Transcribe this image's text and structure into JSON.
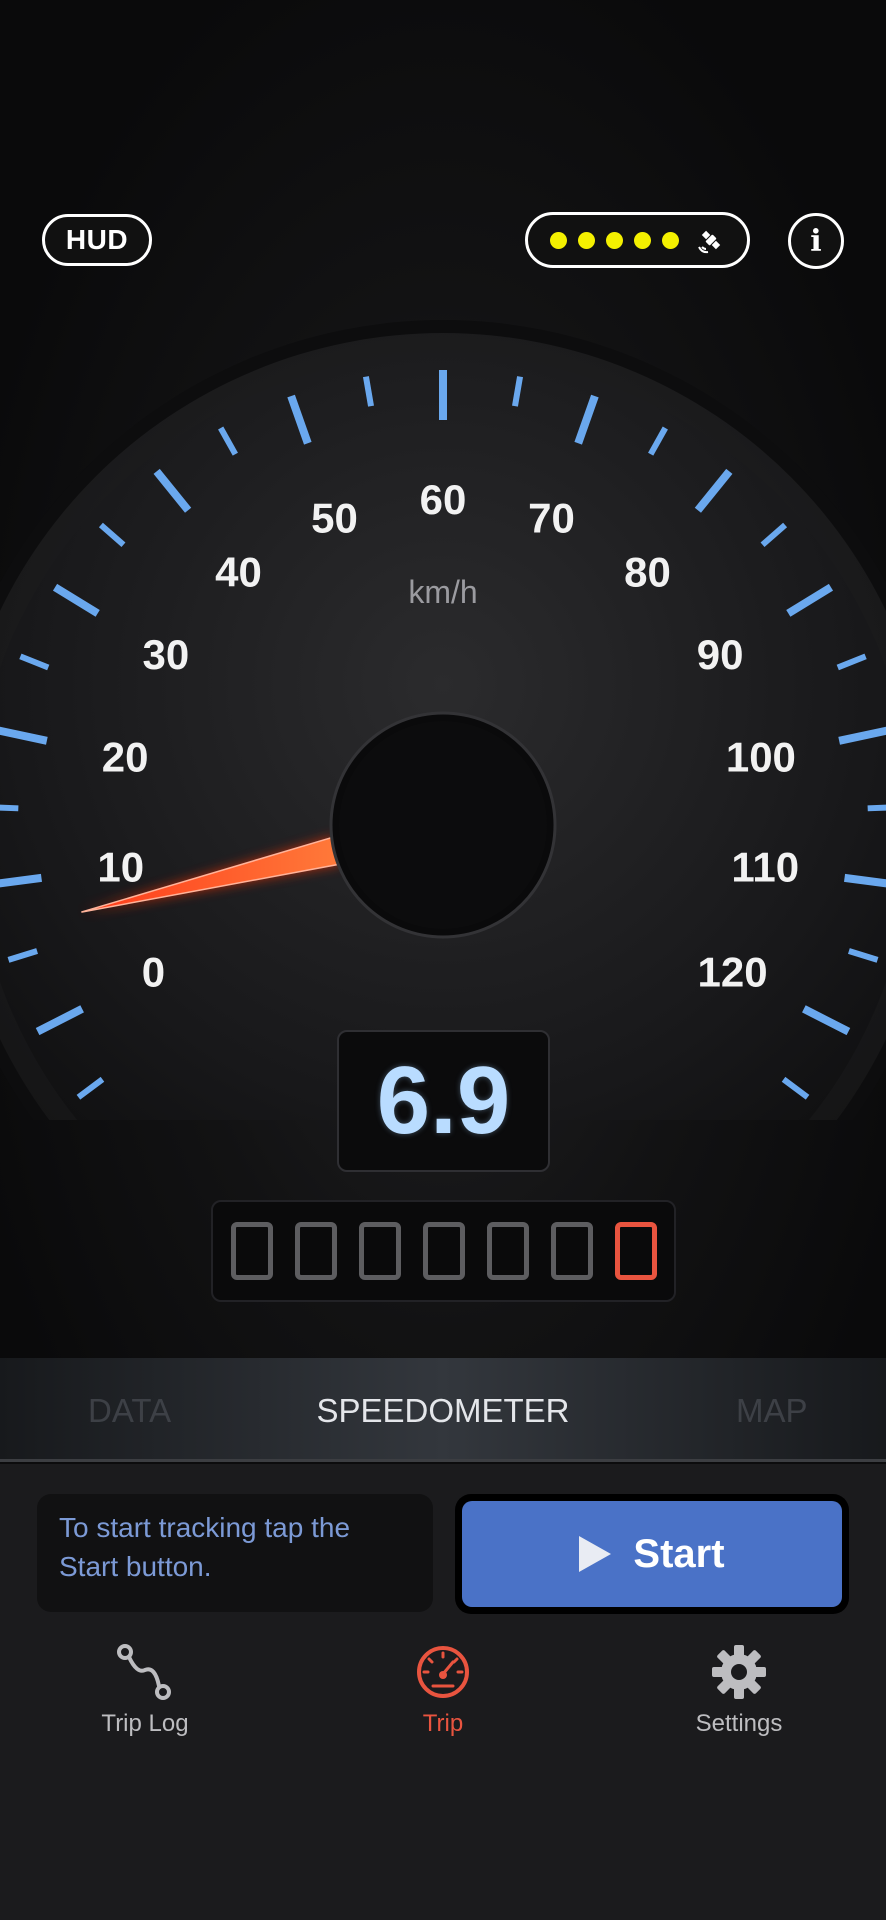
{
  "header": {
    "hud_label": "HUD",
    "gps_signal_bars": 5,
    "info_label": "i"
  },
  "colors": {
    "accent_blue": "#6aa8ee",
    "needle_red": "#ff4a22",
    "digital_speed": "#b9dcff",
    "odometer_active": "#e9543f",
    "start_button": "#4a72c7",
    "gps_dot": "#f4f000"
  },
  "gauge": {
    "unit": "km/h",
    "min": 0,
    "max": 120,
    "labels": [
      "0",
      "10",
      "20",
      "30",
      "40",
      "50",
      "60",
      "70",
      "80",
      "90",
      "100",
      "110",
      "120"
    ],
    "needle_value": 6.9
  },
  "speed": {
    "value": "6.9"
  },
  "odometer": {
    "digits": [
      "0",
      "0",
      "0",
      "0",
      "0",
      "0",
      "0"
    ]
  },
  "modes": {
    "left": "DATA",
    "center": "SPEEDOMETER",
    "right": "MAP"
  },
  "tracking": {
    "message": "To start tracking tap the Start button.",
    "start_label": "Start"
  },
  "tabs": [
    {
      "label": "Trip Log",
      "icon": "route-icon",
      "active": false
    },
    {
      "label": "Trip",
      "icon": "speedometer-icon",
      "active": true
    },
    {
      "label": "Settings",
      "icon": "gear-icon",
      "active": false
    }
  ]
}
